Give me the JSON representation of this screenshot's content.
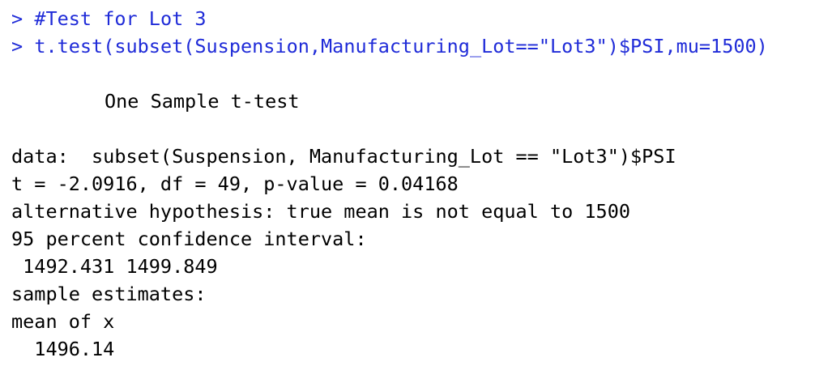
{
  "console": {
    "prompt_symbol": ">",
    "commands": [
      "#Test for Lot 3",
      "t.test(subset(Suspension,Manufacturing_Lot==\"Lot3\")$PSI,mu=1500)"
    ],
    "output": {
      "heading": "One Sample t-test",
      "data_line": "data:  subset(Suspension, Manufacturing_Lot == \"Lot3\")$PSI",
      "stats_line": "t = -2.0916, df = 49, p-value = 0.04168",
      "alternative_line": "alternative hypothesis: true mean is not equal to 1500",
      "ci_label": "95 percent confidence interval:",
      "ci_values": " 1492.431 1499.849",
      "estimates_label": "sample estimates:",
      "estimate_name": "mean of x",
      "estimate_value": "  1496.14"
    }
  },
  "colors": {
    "command_text": "#1f2bd8",
    "output_text": "#000000",
    "background": "#ffffff"
  }
}
